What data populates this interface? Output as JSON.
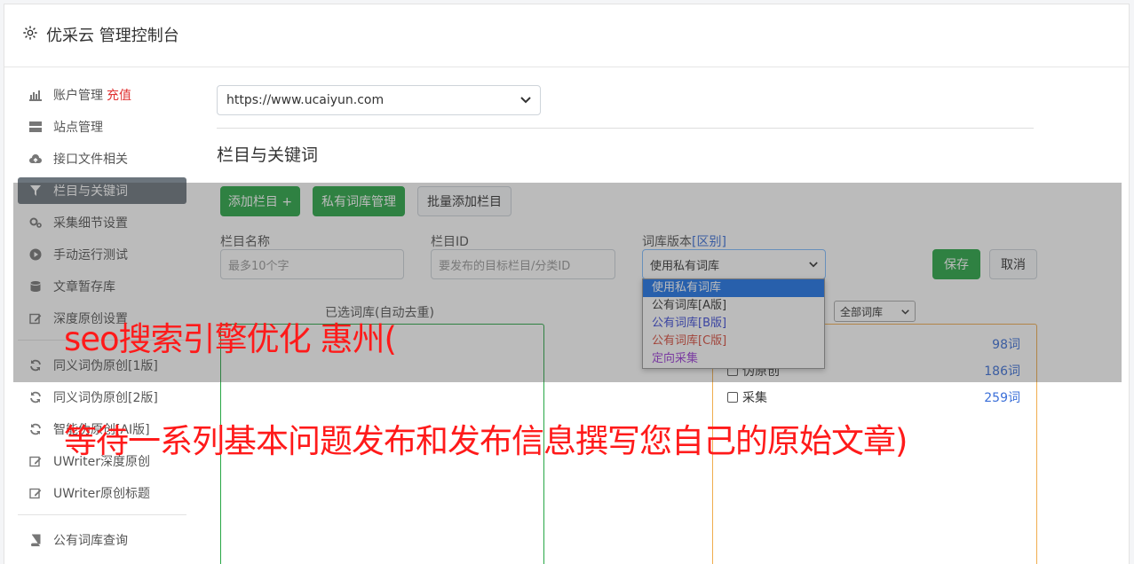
{
  "app": {
    "title": "优采云 管理控制台"
  },
  "sidebar": {
    "items": [
      {
        "label": "账户管理",
        "extra": "充值",
        "icon": "bar-chart-icon"
      },
      {
        "label": "站点管理",
        "icon": "server-icon"
      },
      {
        "label": "接口文件相关",
        "icon": "cloud-upload-icon"
      },
      {
        "label": "栏目与关键词",
        "icon": "filter-icon",
        "active": true
      },
      {
        "label": "采集细节设置",
        "icon": "gears-icon"
      },
      {
        "label": "手动运行测试",
        "icon": "play-circle-icon"
      },
      {
        "label": "文章暂存库",
        "icon": "database-icon"
      },
      {
        "label": "深度原创设置",
        "icon": "edit-icon"
      }
    ],
    "items2": [
      {
        "label": "同义词伪原创[1版]",
        "icon": "refresh-icon"
      },
      {
        "label": "同义词伪原创[2版]",
        "icon": "refresh-icon"
      },
      {
        "label": "智能伪原创[AI版]",
        "icon": "refresh-icon"
      },
      {
        "label": "UWriter深度原创",
        "icon": "edit-icon"
      },
      {
        "label": "UWriter原创标题",
        "icon": "edit-icon"
      }
    ],
    "items3": [
      {
        "label": "公有词库查询",
        "icon": "book-icon"
      }
    ]
  },
  "main": {
    "site_select": "https://www.ucaiyun.com",
    "section_title": "栏目与关键词",
    "buttons": {
      "add_column": "添加栏目 +",
      "private_lib": "私有词库管理",
      "batch_add": "批量添加栏目"
    },
    "form": {
      "name_label": "栏目名称",
      "name_placeholder": "最多10个字",
      "id_label": "栏目ID",
      "id_placeholder": "要发布的目标栏目/分类ID",
      "version_label": "词库版本",
      "version_diff": "[区别]",
      "version_value": "使用私有词库",
      "save": "保存",
      "cancel": "取消"
    },
    "version_options": [
      {
        "label": "使用私有词库",
        "color": "#ffffff"
      },
      {
        "label": "公有词库[A版]",
        "color": "#333333"
      },
      {
        "label": "公有词库[B版]",
        "color": "#3b49d8"
      },
      {
        "label": "公有词库[C版]",
        "color": "#d84b3b"
      },
      {
        "label": "定向采集",
        "color": "#9b3bd8"
      }
    ],
    "selected_title": "已选词库(自动去重)",
    "filter_select": "全部词库",
    "libraries": [
      {
        "label": "",
        "count": "98词"
      },
      {
        "label": "伪原创",
        "count": "186词"
      },
      {
        "label": "采集",
        "count": "259词"
      }
    ]
  },
  "watermark": {
    "line1": "seo搜索引擎优化 惠州(",
    "line2": "等待一系列基本问题发布和发布信息撰写您自己的原始文章)"
  }
}
